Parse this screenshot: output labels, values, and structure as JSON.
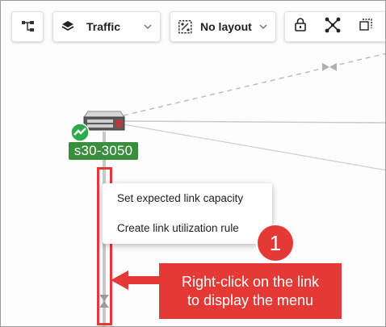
{
  "toolbar": {
    "hierarchy_icon": "hierarchy-icon",
    "layers_label": "Traffic",
    "layout_label": "No layout",
    "icons": [
      "lock-icon",
      "scatter-nodes-icon",
      "fit-screen-icon"
    ]
  },
  "topology": {
    "device_label": "s30-3050",
    "device_status": "up",
    "colors": {
      "device_label_bg": "#3a8d3d",
      "highlight": "#e53935"
    }
  },
  "context_menu": {
    "items": [
      "Set expected link capacity",
      "Create link utilization rule"
    ]
  },
  "annotation": {
    "step": "1",
    "text_line1": "Right-click on the link",
    "text_line2": "to display the menu"
  }
}
